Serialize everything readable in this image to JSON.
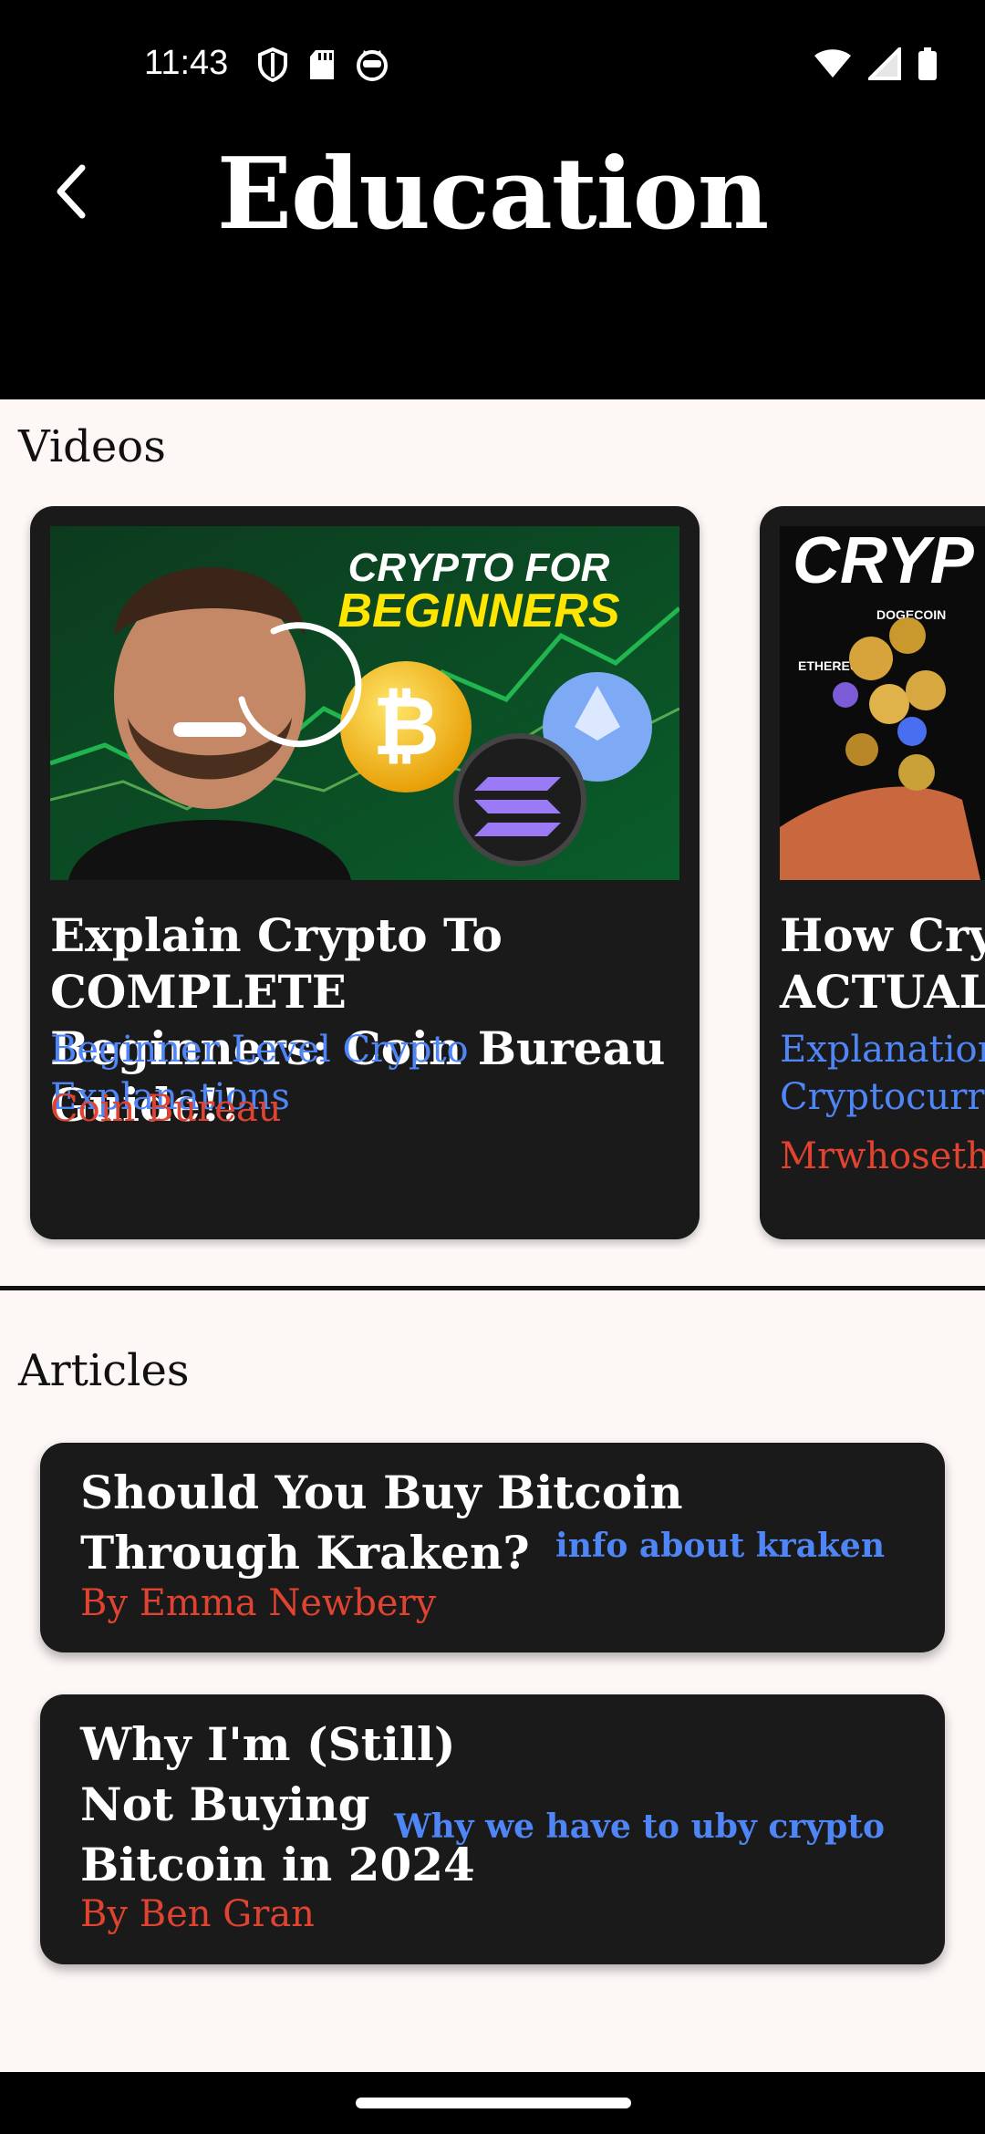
{
  "status_bar": {
    "time": "11:43"
  },
  "header": {
    "title": "Education"
  },
  "videos_section": {
    "title": "Videos",
    "cards": [
      {
        "title": "Explain Crypto To COMPLETE\nBeginners: Coin Bureau Guide!!",
        "category": "Beginner Level Crypto Explanations",
        "channel": "Coin Bureau",
        "thumbnail_text": [
          "CRYPTO FOR",
          "BEGINNERS"
        ]
      },
      {
        "title": "How Cryp\nACTUALL",
        "category": "Explanation\nCryptocurre",
        "channel": "Mrwhoseth",
        "thumbnail_text": [
          "CRYP",
          "DOGECOIN",
          "ETHEREUM"
        ]
      }
    ]
  },
  "articles_section": {
    "title": "Articles",
    "items": [
      {
        "title": "Should You Buy Bitcoin\nThrough Kraken?",
        "author": "By Emma Newbery",
        "link": "info about kraken"
      },
      {
        "title": "Why I'm (Still)\nNot Buying\nBitcoin in 2024",
        "author": "By Ben Gran",
        "link": "Why we have to uby crypto"
      }
    ]
  },
  "colors": {
    "accent_blue": "#4f86f7",
    "accent_red": "#e0432f",
    "card_bg": "#1b1a1b",
    "page_bg": "#fdf7f6"
  }
}
